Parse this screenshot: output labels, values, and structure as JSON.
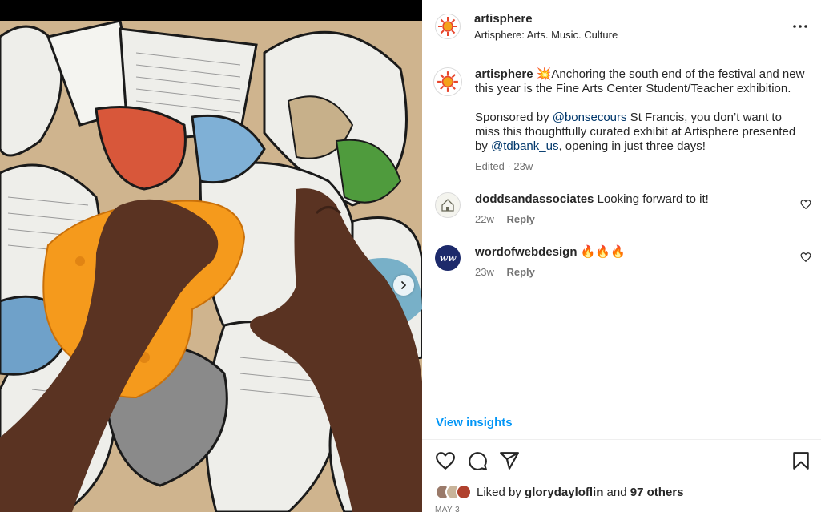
{
  "post": {
    "image_alt": "",
    "next_arrow_icon": "chevron-right-icon"
  },
  "header": {
    "username": "artisphere",
    "subtitle": "Artisphere: Arts. Music. Culture",
    "more_icon": "more-horizontal-icon"
  },
  "caption": {
    "username": "artisphere",
    "emoji": "💥",
    "text_1": "Anchoring the south end of the festival and new this year is the Fine Arts Center Student/Teacher exhibition.",
    "text_2a": "Sponsored by ",
    "mention_1": "@bonsecours",
    "text_2b": " St Francis, you don’t want to miss this thoughtfully curated exhibit at Artisphere presented by ",
    "mention_2": "@tdbank_us",
    "text_2c": ", opening in just three days!",
    "meta": "Edited · 23w"
  },
  "comments": [
    {
      "username": "doddsandassociates",
      "text": "Looking forward to it!",
      "time": "22w",
      "reply": "Reply",
      "avatar_color": "#f2f2ec"
    },
    {
      "username": "wordofwebdesign",
      "text": "🔥🔥🔥",
      "time": "23w",
      "reply": "Reply",
      "avatar_color": "#1d2a6b",
      "avatar_text": "ww"
    }
  ],
  "insights": {
    "label": "View insights"
  },
  "actions": {
    "like_icon": "heart-icon",
    "comment_icon": "comment-icon",
    "share_icon": "send-icon",
    "save_icon": "bookmark-icon"
  },
  "likes": {
    "prefix": "Liked by ",
    "user": "glorydayloflin",
    "middle": " and ",
    "others": "97 others"
  },
  "date": "MAY 3",
  "colors": {
    "link": "#00376b",
    "accent": "#0095f6",
    "muted": "#737373"
  }
}
